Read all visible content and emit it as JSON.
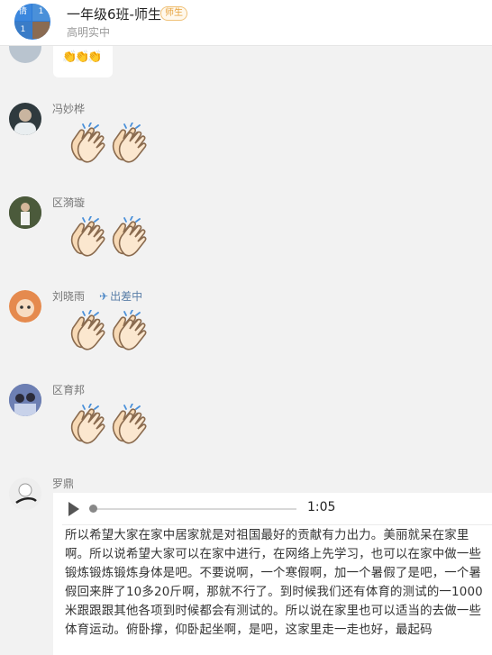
{
  "header": {
    "title": "一年级6班-师生",
    "role_badge": "师生",
    "subtitle": "高明实中",
    "group_avatar_chars": [
      "倩",
      "1",
      "1",
      ""
    ]
  },
  "messages": [
    {
      "sender": "冯妙桦",
      "content": "clap-emoji x2"
    },
    {
      "sender": "区漪璇",
      "content": "clap-emoji x2"
    },
    {
      "sender": "刘晓雨",
      "status": "出差中",
      "content": "clap-emoji x2"
    },
    {
      "sender": "区育邦",
      "content": "clap-emoji x2"
    },
    {
      "sender": "罗鼎",
      "voice": {
        "duration": "1:05",
        "progress": 0
      },
      "transcript": "所以希望大家在家中居家就是对祖国最好的贡献有力出力。美丽就呆在家里啊。所以说希望大家可以在家中进行，在网络上先学习，也可以在家中做一些锻炼锻炼锻炼身体是吧。不要说啊，一个寒假啊，加一个暑假了是吧，一个暑假回来胖了10多20斤啊，那就不行了。到时候我们还有体育的测试的一1000米跟跟跟其他各项到时候都会有测试的。所以说在家里也可以适当的去做一些体育运动。俯卧撑，仰卧起坐啊，是吧，这家里走一走也好，最起码"
    }
  ],
  "colors": {
    "background": "#f2f2f2",
    "bubble": "#ffffff",
    "badge": "#e6a23c",
    "header_avatar": "#2d7ad6"
  }
}
